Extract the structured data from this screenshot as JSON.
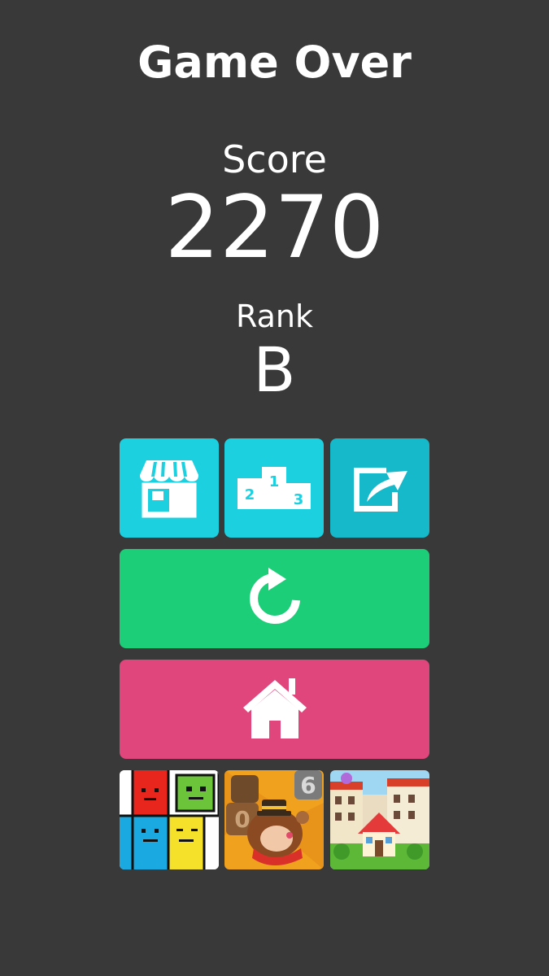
{
  "game_over": {
    "title": "Game Over",
    "score_label": "Score",
    "score": "2270",
    "rank_label": "Rank",
    "rank": "B"
  },
  "buttons": {
    "shop_icon": "shop-icon",
    "ranking_icon": "podium-icon",
    "share_icon": "share-icon",
    "retry_icon": "retry-icon",
    "home_icon": "home-icon",
    "podium_places": [
      "2",
      "1",
      "3"
    ]
  },
  "ads": [
    {
      "icon": "face-blocks-game-icon"
    },
    {
      "icon": "dog-cookie-game-icon"
    },
    {
      "icon": "town-houses-game-icon"
    }
  ],
  "colors": {
    "background": "#393939",
    "cyan": "#1cd0e0",
    "cyan_dark": "#16b9c9",
    "green": "#1dce78",
    "pink": "#e0457c"
  }
}
